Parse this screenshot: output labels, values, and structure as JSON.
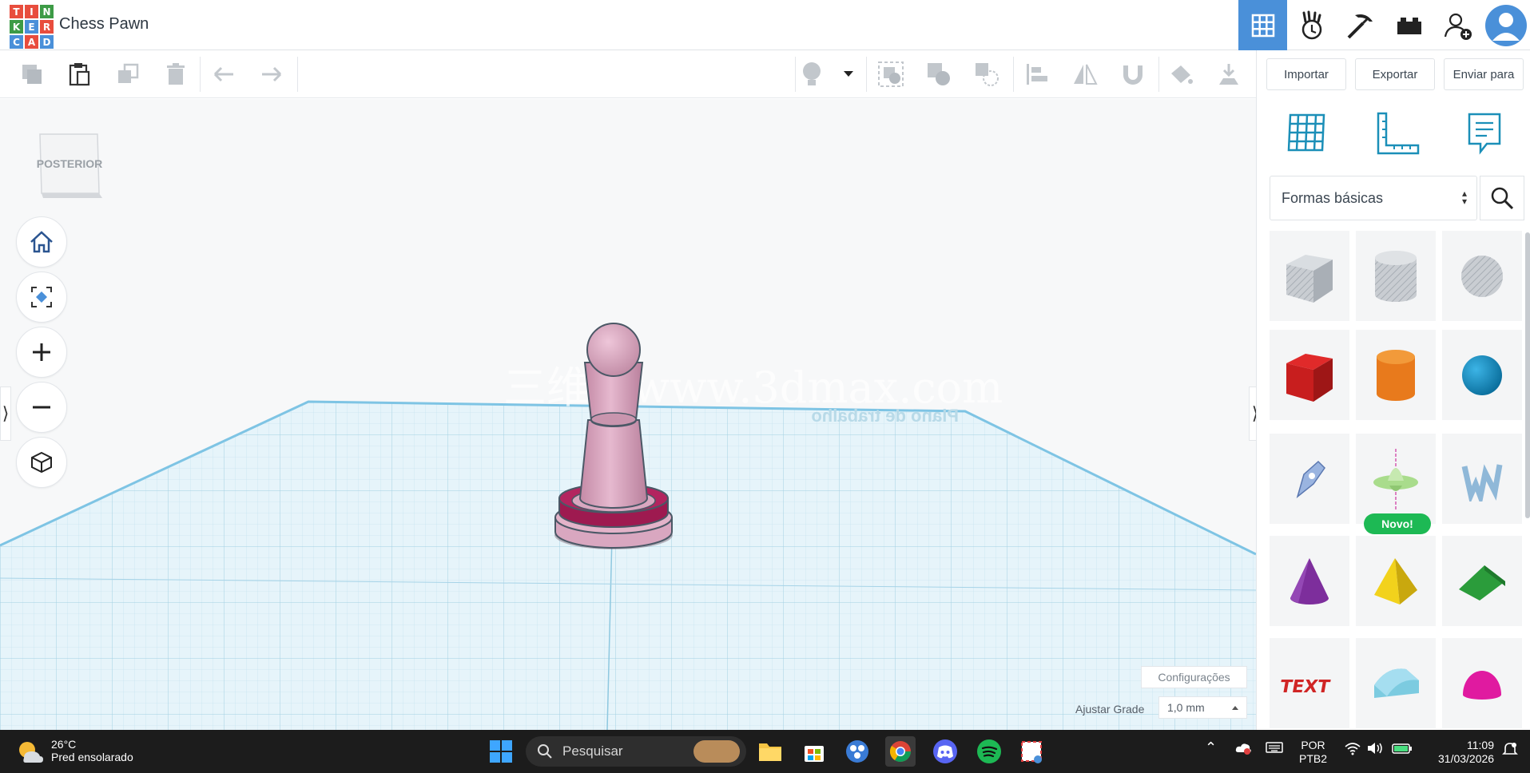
{
  "header": {
    "logo_letters": [
      "T",
      "I",
      "N",
      "K",
      "E",
      "R",
      "C",
      "A",
      "D"
    ],
    "logo_colors": [
      "#e84d3d",
      "#e84d3d",
      "#3d9b46",
      "#3d9b46",
      "#4a90d9",
      "#e84d3d",
      "#4a90d9",
      "#e84d3d",
      "#4a90d9"
    ],
    "project_title": "Chess Pawn",
    "icons": [
      "grid-view-icon",
      "activity-icon",
      "pickaxe-icon",
      "brick-icon",
      "add-user-icon",
      "user-avatar-icon"
    ]
  },
  "toolbar": {
    "left_icons": [
      "copy-icon",
      "paste-icon",
      "duplicate-icon",
      "trash-icon",
      "undo-icon",
      "redo-icon"
    ],
    "right_icons": [
      "light-bulb-icon",
      "dropdown-icon",
      "group-icon",
      "union-icon",
      "hole-icon",
      "align-icon",
      "mirror-icon",
      "magnet-icon",
      "paint-icon",
      "drop-to-workplane-icon"
    ],
    "import_label": "Importar",
    "export_label": "Exportar",
    "send_label": "Enviar para"
  },
  "viewport": {
    "view_cube_label": "POSTERIOR",
    "workplane_label": "Plano de trabalho",
    "nav_buttons": [
      "home-icon",
      "fit-view-icon",
      "zoom-in-icon",
      "zoom-out-icon",
      "orthographic-icon"
    ],
    "config_label": "Configurações",
    "grid_label": "Ajustar Grade",
    "grid_value": "1,0 mm",
    "watermark": "三维网www.3dmax.com"
  },
  "right_panel": {
    "top_icons": [
      "workplane-icon",
      "ruler-icon",
      "notes-icon"
    ],
    "shape_category": "Formas básicas",
    "new_badge": "Novo!",
    "shapes": [
      "box-hole",
      "cylinder-hole",
      "sphere-hole",
      "box",
      "cylinder",
      "sphere",
      "scribble",
      "parametric",
      "text-shape",
      "cone",
      "pyramid",
      "roof",
      "text",
      "half-cylinder",
      "paraboloid"
    ]
  },
  "taskbar": {
    "temperature": "26°C",
    "condition": "Pred ensolarado",
    "search_placeholder": "Pesquisar",
    "apps": [
      "windows-start-icon",
      "file-explorer-icon",
      "store-icon",
      "app-icon",
      "chrome-icon",
      "discord-icon",
      "spotify-icon",
      "snipping-tool-icon"
    ],
    "lang_top": "POR",
    "lang_bottom": "PTB2",
    "time": "11:09",
    "date": "31/03/2026"
  },
  "colors": {
    "accent": "#4a90d9",
    "pawn": "#d9a7c0",
    "pawn_base": "#b01e5a",
    "workplane": "#e3f3f9"
  }
}
